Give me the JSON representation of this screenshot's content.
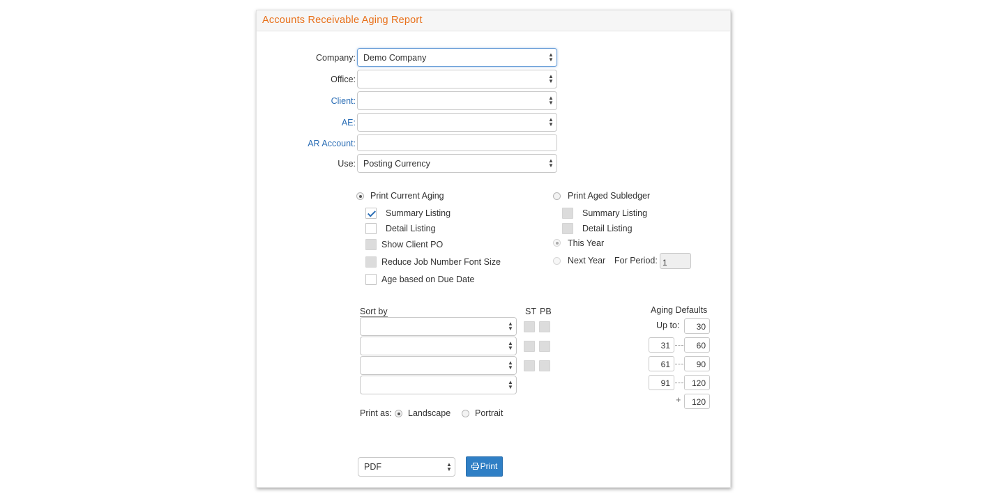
{
  "title": "Accounts Receivable Aging Report",
  "fields": {
    "company_label": "Company:",
    "company_value": "Demo Company",
    "office_label": "Office:",
    "office_value": "",
    "client_label": "Client:",
    "client_value": "",
    "ae_label": "AE:",
    "ae_value": "",
    "ar_account_label": "AR Account:",
    "ar_account_value": "",
    "use_label": "Use:",
    "use_value": "Posting Currency"
  },
  "current_aging": {
    "label": "Print Current Aging",
    "selected": true,
    "summary_listing": "Summary Listing",
    "summary_checked": true,
    "detail_listing": "Detail Listing",
    "show_client_po": "Show Client PO",
    "reduce_font": "Reduce Job Number Font Size",
    "age_due_date": "Age based on Due Date"
  },
  "aged_subledger": {
    "label": "Print Aged Subledger",
    "summary_listing": "Summary Listing",
    "detail_listing": "Detail Listing",
    "this_year": "This Year",
    "next_year": "Next Year",
    "for_period_label": "For Period:",
    "for_period_value": "1"
  },
  "sort": {
    "label": "Sort by",
    "st": "ST",
    "pb": "PB"
  },
  "aging_defaults": {
    "title": "Aging Defaults",
    "up_to_label": "Up to:",
    "up_to": "30",
    "ranges": [
      {
        "from": "31",
        "to": "60"
      },
      {
        "from": "61",
        "to": "90"
      },
      {
        "from": "91",
        "to": "120"
      }
    ],
    "plus_label": "+",
    "plus_value": "120"
  },
  "print_as": {
    "label": "Print as:",
    "landscape": "Landscape",
    "portrait": "Portrait",
    "selected": "Landscape"
  },
  "output": {
    "format": "PDF",
    "print_label": "Print"
  },
  "icons": {
    "select_arrows": "updown-arrows-icon",
    "print": "printer-icon"
  },
  "colors": {
    "title": "#e8701a",
    "link_label": "#2a6db5",
    "print_button": "#2f7fc5"
  }
}
